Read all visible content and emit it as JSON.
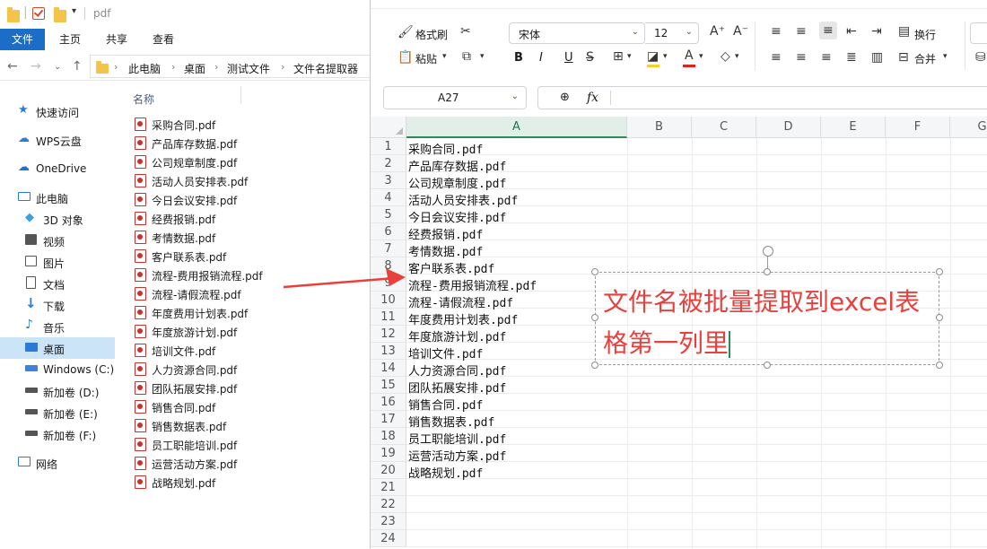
{
  "explorer": {
    "title": "pdf",
    "ribbon_tabs": [
      "文件",
      "主页",
      "共享",
      "查看"
    ],
    "breadcrumb": [
      "此电脑",
      "桌面",
      "测试文件",
      "文件名提取器"
    ],
    "column_header": "名称",
    "sidebar": [
      {
        "label": "快速访问",
        "icon": "star-icon"
      },
      {
        "label": "WPS云盘",
        "icon": "cloud-icon"
      },
      {
        "label": "OneDrive",
        "icon": "cloud-icon"
      },
      {
        "label": "此电脑",
        "icon": "computer-icon"
      },
      {
        "label": "3D 对象",
        "icon": "cube-icon"
      },
      {
        "label": "视频",
        "icon": "video-icon"
      },
      {
        "label": "图片",
        "icon": "picture-icon"
      },
      {
        "label": "文档",
        "icon": "document-icon"
      },
      {
        "label": "下载",
        "icon": "download-icon"
      },
      {
        "label": "音乐",
        "icon": "music-icon"
      },
      {
        "label": "桌面",
        "icon": "desktop-icon"
      },
      {
        "label": "Windows (C:)",
        "icon": "drive-icon"
      },
      {
        "label": "新加卷 (D:)",
        "icon": "drive-icon"
      },
      {
        "label": "新加卷 (E:)",
        "icon": "drive-icon"
      },
      {
        "label": "新加卷 (F:)",
        "icon": "drive-icon"
      },
      {
        "label": "网络",
        "icon": "network-icon"
      }
    ],
    "files": [
      "采购合同.pdf",
      "产品库存数据.pdf",
      "公司规章制度.pdf",
      "活动人员安排表.pdf",
      "今日会议安排.pdf",
      "经费报销.pdf",
      "考情数据.pdf",
      "客户联系表.pdf",
      "流程-费用报销流程.pdf",
      "流程-请假流程.pdf",
      "年度费用计划表.pdf",
      "年度旅游计划.pdf",
      "培训文件.pdf",
      "人力资源合同.pdf",
      "团队拓展安排.pdf",
      "销售合同.pdf",
      "销售数据表.pdf",
      "员工职能培训.pdf",
      "运营活动方案.pdf",
      "战略规划.pdf"
    ]
  },
  "spreadsheet": {
    "toolbar": {
      "format_painter": "格式刷",
      "paste": "粘贴",
      "font_name": "宋体",
      "font_size": "12",
      "wrap": "换行",
      "merge": "合并",
      "bold": "B",
      "italic": "I",
      "underline": "U"
    },
    "name_box": "A27",
    "fx_label": "fx",
    "columns": [
      "A",
      "B",
      "C",
      "D",
      "E",
      "F",
      "G"
    ],
    "row_numbers": [
      "1",
      "2",
      "3",
      "4",
      "5",
      "6",
      "7",
      "8",
      "9",
      "10",
      "11",
      "12",
      "13",
      "14",
      "15",
      "16",
      "17",
      "18",
      "19",
      "20",
      "21",
      "22",
      "23",
      "24"
    ],
    "cells_a": [
      "采购合同.pdf",
      "产品库存数据.pdf",
      "公司规章制度.pdf",
      "活动人员安排表.pdf",
      "今日会议安排.pdf",
      "经费报销.pdf",
      "考情数据.pdf",
      "客户联系表.pdf",
      "流程-费用报销流程.pdf",
      "流程-请假流程.pdf",
      "年度费用计划表.pdf",
      "年度旅游计划.pdf",
      "培训文件.pdf",
      "人力资源合同.pdf",
      "团队拓展安排.pdf",
      "销售合同.pdf",
      "销售数据表.pdf",
      "员工职能培训.pdf",
      "运营活动方案.pdf",
      "战略规划.pdf"
    ],
    "annotation": "文件名被批量提取到excel表格第一列里",
    "annotation_color": "#e8403c"
  },
  "colors": {
    "ribbon_active": "#1a6ec8",
    "selected_nav": "#cce4f7",
    "arrow": "#e8403c",
    "accent_green": "#2b8a5a"
  }
}
